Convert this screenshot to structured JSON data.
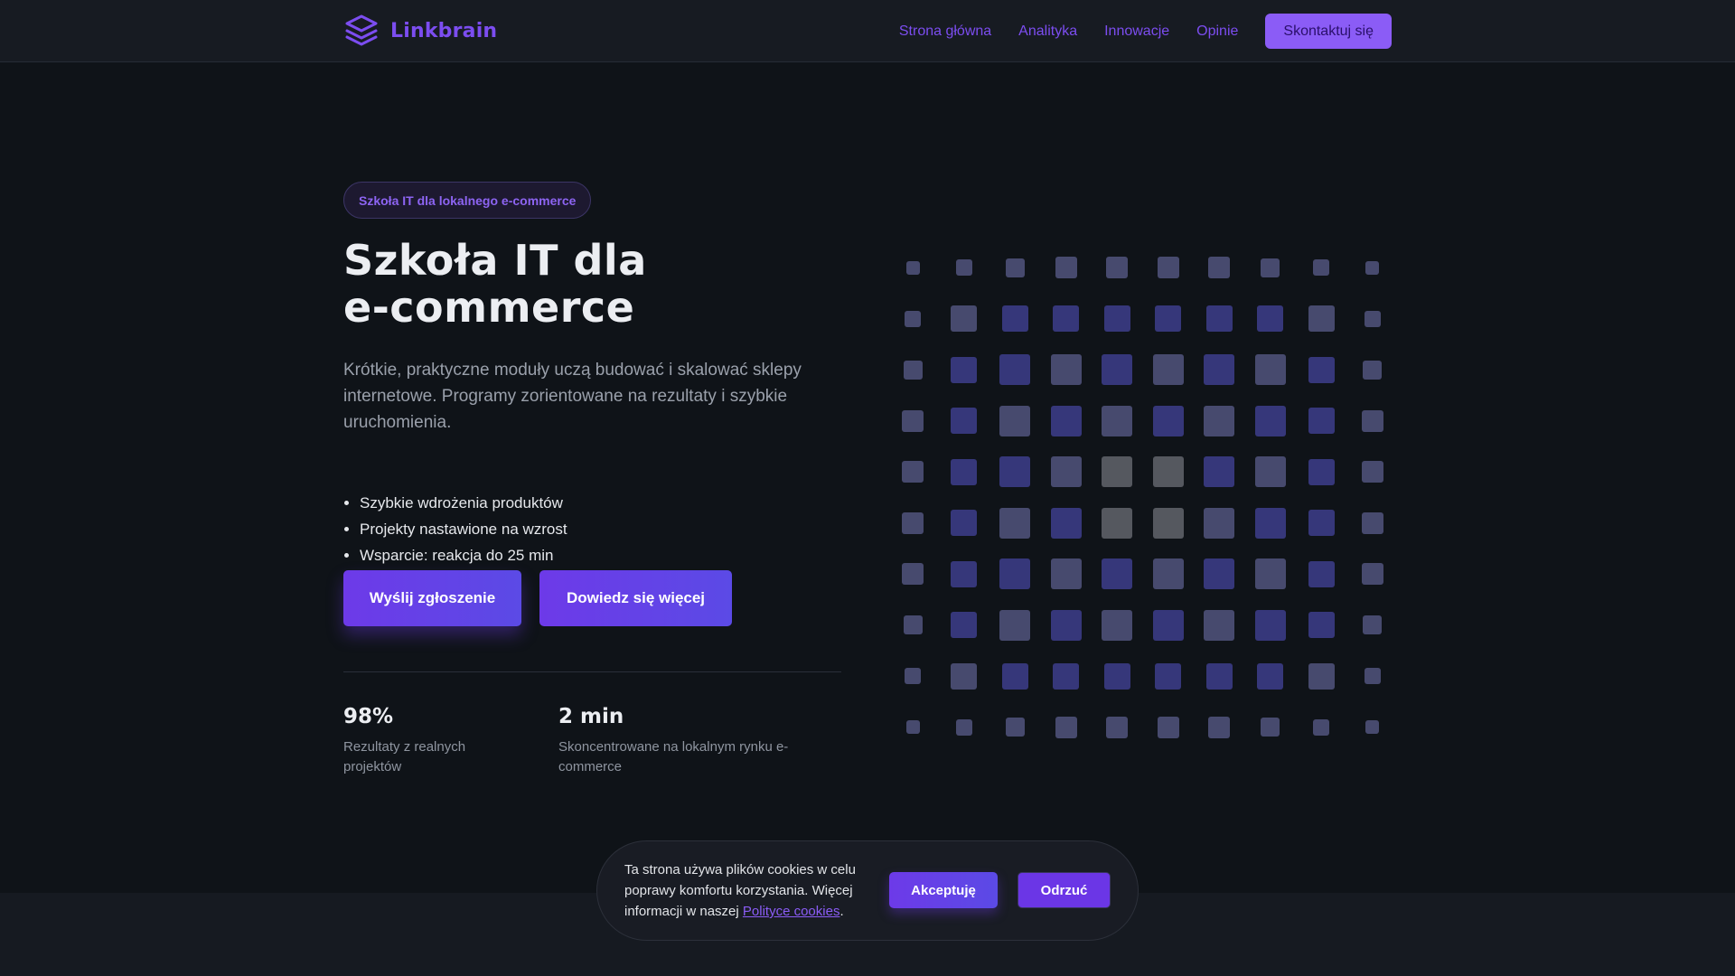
{
  "brand": {
    "name": "Linkbrain",
    "logo_icon": "layers-icon"
  },
  "nav": {
    "items": [
      {
        "label": "Strona główna"
      },
      {
        "label": "Analityka"
      },
      {
        "label": "Innowacje"
      },
      {
        "label": "Opinie"
      }
    ],
    "cta_label": "Skontaktuj się"
  },
  "hero": {
    "badge": "Szkoła IT dla lokalnego e-commerce",
    "title_line1": "Szkoła IT dla",
    "title_line2": "e-commerce",
    "description": "Krótkie, praktyczne moduły uczą budować i skalować sklepy internetowe. Programy zorientowane na rezultaty i szybkie uruchomienia.",
    "features": [
      "Szybkie wdrożenia produktów",
      "Projekty nastawione na wzrost",
      "Wsparcie: reakcja do 25 min"
    ],
    "primary_button": "Wyślij zgłoszenie",
    "secondary_button": "Dowiedz się więcej"
  },
  "stats": [
    {
      "value": "98%",
      "label": "Rezultaty z realnych projektów"
    },
    {
      "value": "2 min",
      "label": "Skoncentrowane na lokalnym rynku e-commerce"
    }
  ],
  "cookie": {
    "text_before_link": "Ta strona używa plików cookies w celu poprawy komfortu korzystania. Więcej informacji w naszej ",
    "link_text": "Polityce cookies",
    "text_after_link": ".",
    "accept_label": "Akceptuję",
    "reject_label": "Odrzuć"
  },
  "colors": {
    "accent": "#7c4df0",
    "button": "#6d3ae8",
    "background": "#0f1318",
    "header": "#171b22",
    "tile_indigo": "#36377a",
    "tile_slate": "#474a6e",
    "tile_gray": "#55585f"
  }
}
